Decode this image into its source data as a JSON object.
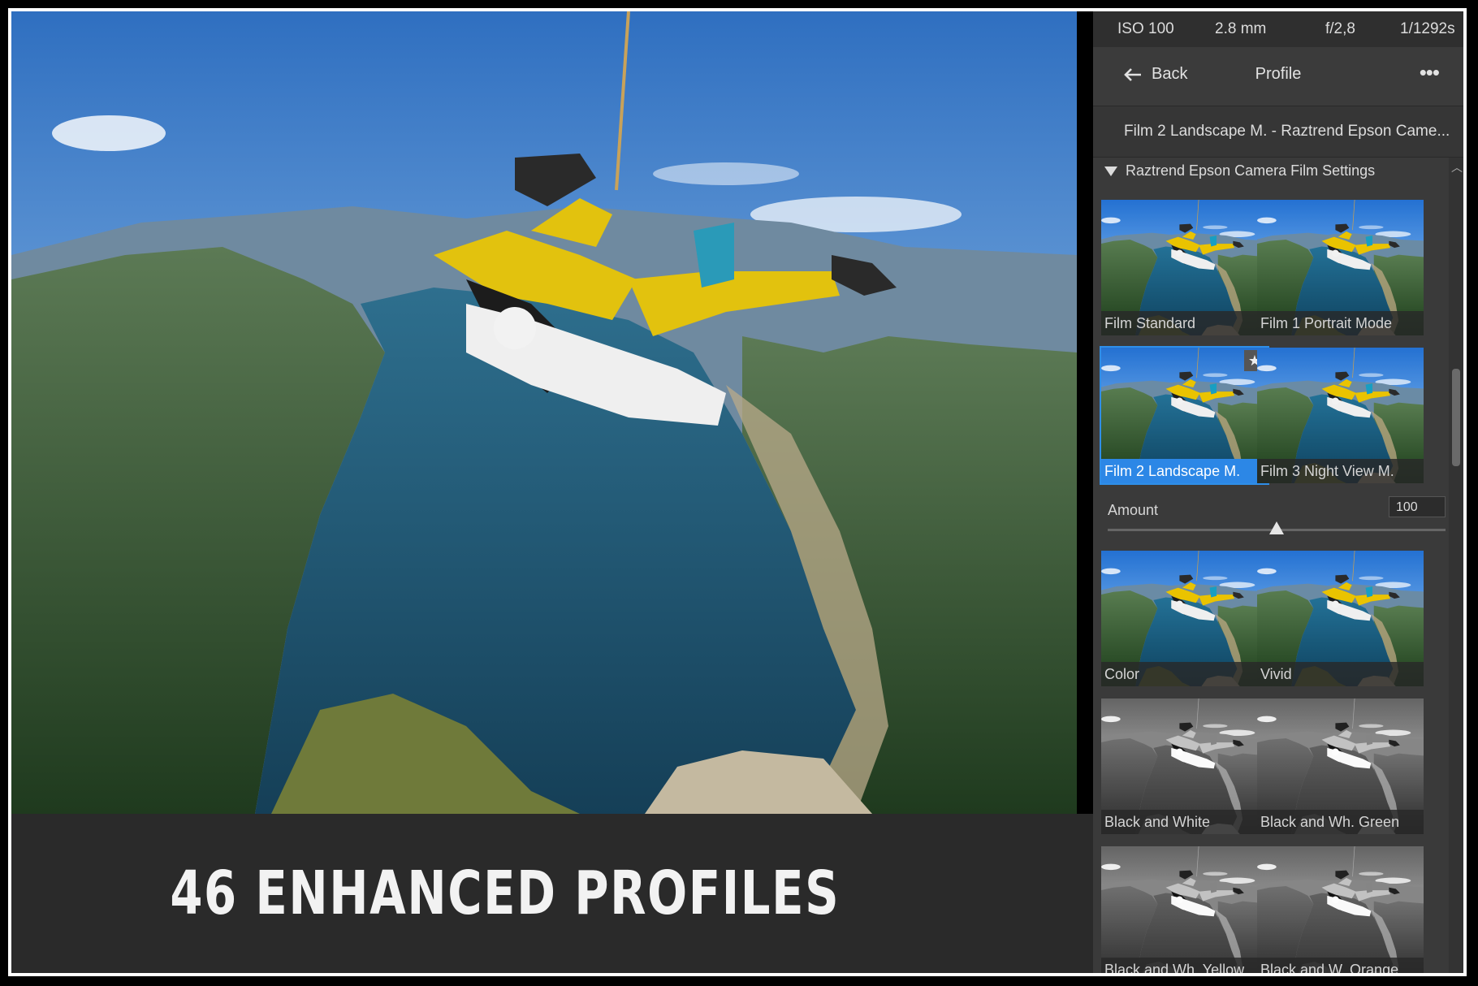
{
  "exif": {
    "iso": "ISO 100",
    "focal": "2.8 mm",
    "aperture": "f/2,8",
    "shutter": "1/1292s"
  },
  "nav": {
    "back_label": "Back",
    "title": "Profile",
    "more_icon": "ellipsis-icon"
  },
  "current_profile": "Film 2 Landscape M. - Raztrend Epson Came...",
  "group": {
    "name": "Raztrend Epson Camera Film Settings"
  },
  "profiles": [
    {
      "label": "Film Standard",
      "style": "color"
    },
    {
      "label": "Film 1 Portrait Mode",
      "style": "color"
    },
    {
      "label": "Film 2 Landscape M.",
      "style": "color",
      "selected": true,
      "favorite": true
    },
    {
      "label": "Film 3 Night View M.",
      "style": "color"
    },
    {
      "label": "Color",
      "style": "color"
    },
    {
      "label": "Vivid",
      "style": "color"
    },
    {
      "label": "Black and White",
      "style": "bw"
    },
    {
      "label": "Black and Wh. Green",
      "style": "bw"
    },
    {
      "label": "Black and Wh. Yellow",
      "style": "bw"
    },
    {
      "label": "Black and W. Orange",
      "style": "bw"
    }
  ],
  "amount": {
    "label": "Amount",
    "value": "100",
    "fraction": 0.5
  },
  "caption": "46 ENHANCED PROFILES",
  "colors": {
    "accent": "#2c87e6",
    "panel": "#3a3a3a",
    "sky": "#3f7fc8",
    "lake": "#1b4e6b"
  }
}
